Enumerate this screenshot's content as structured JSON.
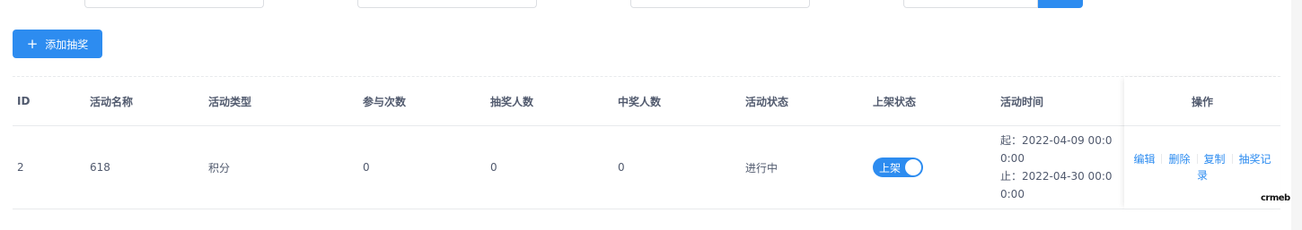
{
  "toolbar": {
    "add_label": "添加抽奖",
    "add_icon": "plus-icon"
  },
  "table": {
    "headers": {
      "id": "ID",
      "name": "活动名称",
      "type": "活动类型",
      "participations": "参与次数",
      "drawers": "抽奖人数",
      "winners": "中奖人数",
      "activity_status": "活动状态",
      "shelf_status": "上架状态",
      "activity_time": "活动时间",
      "actions": "操作"
    },
    "rows": [
      {
        "id": "2",
        "name": "618",
        "type": "积分",
        "participations": "0",
        "drawers": "0",
        "winners": "0",
        "activity_status": "进行中",
        "shelf_status_label": "上架",
        "shelf_on": true,
        "time_start": "起：2022-04-09 00:00:00",
        "time_end": "止：2022-04-30 00:00:00",
        "actions": {
          "edit": "编辑",
          "delete": "删除",
          "copy": "复制",
          "records": "抽奖记录"
        }
      }
    ]
  },
  "watermark": "crmeb",
  "colors": {
    "primary": "#2d8cf0",
    "text": "#515a6e",
    "border": "#e8eaec"
  }
}
